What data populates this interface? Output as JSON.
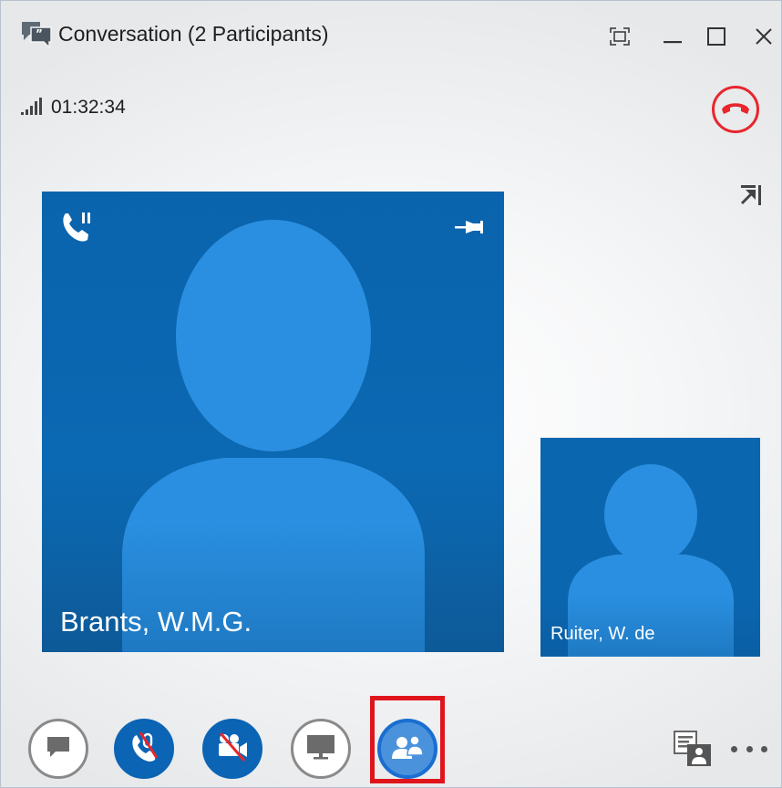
{
  "window": {
    "title": "Conversation (2 Participants)",
    "app_icon": "conversation-bubble-icon",
    "controls": [
      "full-screen-icon",
      "minimize-icon",
      "maximize-icon",
      "close-icon"
    ]
  },
  "call": {
    "signal_icon": "signal-strength-icon",
    "duration": "01:32:34",
    "hangup_icon": "hang-up-icon",
    "hangup_color": "#e8262c",
    "popout_icon": "pop-out-video-icon"
  },
  "participants": [
    {
      "name": "Brants, W.M.G.",
      "status_icon": "call-on-hold-icon",
      "pin_icon": "pin-icon"
    },
    {
      "name": "Ruiter, W. de"
    }
  ],
  "toolbar": {
    "buttons": [
      {
        "name": "instant-message",
        "icon": "chat-bubble-icon"
      },
      {
        "name": "audio",
        "icon": "phone-muted-icon"
      },
      {
        "name": "video",
        "icon": "video-off-icon"
      },
      {
        "name": "present",
        "icon": "monitor-icon"
      },
      {
        "name": "participants",
        "icon": "people-icon",
        "highlighted": true
      }
    ],
    "right": [
      "conversation-pane-icon",
      "more-options-icon"
    ]
  },
  "colors": {
    "tile_blue": "#0b66b0",
    "avatar_blue": "#2a8fe0",
    "highlight": "#e0151c"
  }
}
